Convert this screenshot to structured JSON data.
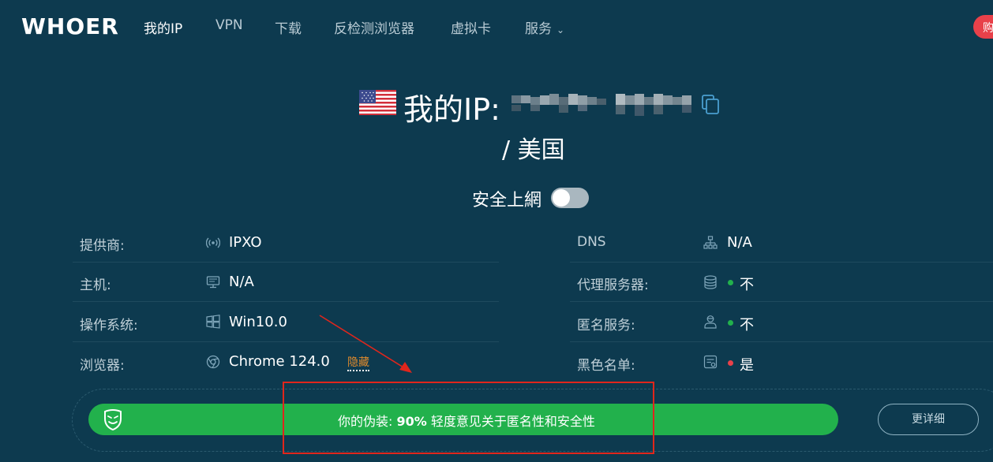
{
  "header": {
    "logo": "WHOER",
    "nav": [
      {
        "label": "我的IP",
        "active": true
      },
      {
        "label": "VPN",
        "active": false
      },
      {
        "label": "下载",
        "active": false
      },
      {
        "label": "反检测浏览器",
        "active": false
      },
      {
        "label": "虚拟卡",
        "active": false
      },
      {
        "label": "服务",
        "active": false,
        "dropdown": true
      }
    ],
    "corner_badge": "购"
  },
  "ip": {
    "label": "我的IP:",
    "country": "/ 美国",
    "flag_icon": "us-flag-icon",
    "copy_icon": "copy-icon"
  },
  "safe": {
    "label": "安全上網",
    "enabled": false
  },
  "left_info": [
    {
      "key": "提供商:",
      "icon": "antenna-icon",
      "value": "IPXO"
    },
    {
      "key": "主机:",
      "icon": "monitor-icon",
      "value": "N/A"
    },
    {
      "key": "操作系统:",
      "icon": "windows-icon",
      "value": "Win10.0"
    },
    {
      "key": "浏览器:",
      "icon": "chrome-icon",
      "value": "Chrome 124.0",
      "link": "隐藏"
    }
  ],
  "right_info": [
    {
      "key": "DNS",
      "icon": "network-icon",
      "value": "N/A"
    },
    {
      "key": "代理服务器:",
      "icon": "database-icon",
      "value": "不",
      "status_color": "#22b14c"
    },
    {
      "key": "匿名服务:",
      "icon": "user-icon",
      "value": "不",
      "status_color": "#22b14c"
    },
    {
      "key": "黑色名单:",
      "icon": "list-icon",
      "value": "是",
      "status_color": "#e8414a"
    }
  ],
  "disguise": {
    "prefix": "你的伪装: ",
    "percent": "90%",
    "suffix": " 轻度意见关于匿名性和安全性",
    "button": "更详细",
    "icon": "mask-icon"
  },
  "colors": {
    "background": "#0d3a4f",
    "bar": "#22b14c",
    "accent_red": "#e8414a",
    "link_orange": "#e08a2c",
    "annotation_red": "#e0261c"
  }
}
